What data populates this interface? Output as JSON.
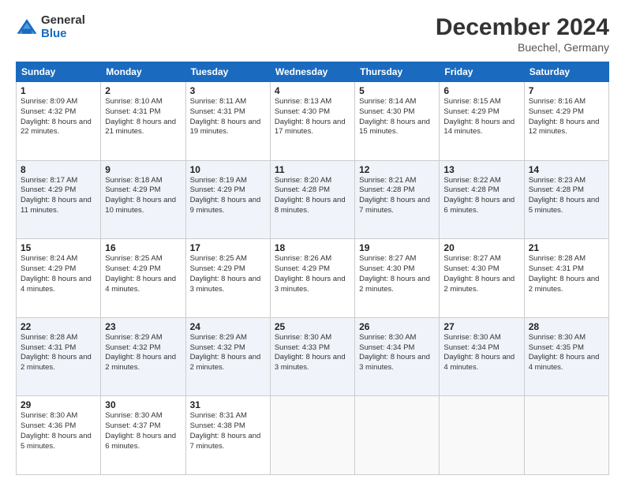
{
  "logo": {
    "general": "General",
    "blue": "Blue"
  },
  "title": "December 2024",
  "subtitle": "Buechel, Germany",
  "days_of_week": [
    "Sunday",
    "Monday",
    "Tuesday",
    "Wednesday",
    "Thursday",
    "Friday",
    "Saturday"
  ],
  "weeks": [
    [
      {
        "day": "1",
        "sunrise": "8:09 AM",
        "sunset": "4:32 PM",
        "daylight": "8 hours and 22 minutes."
      },
      {
        "day": "2",
        "sunrise": "8:10 AM",
        "sunset": "4:31 PM",
        "daylight": "8 hours and 21 minutes."
      },
      {
        "day": "3",
        "sunrise": "8:11 AM",
        "sunset": "4:31 PM",
        "daylight": "8 hours and 19 minutes."
      },
      {
        "day": "4",
        "sunrise": "8:13 AM",
        "sunset": "4:30 PM",
        "daylight": "8 hours and 17 minutes."
      },
      {
        "day": "5",
        "sunrise": "8:14 AM",
        "sunset": "4:30 PM",
        "daylight": "8 hours and 15 minutes."
      },
      {
        "day": "6",
        "sunrise": "8:15 AM",
        "sunset": "4:29 PM",
        "daylight": "8 hours and 14 minutes."
      },
      {
        "day": "7",
        "sunrise": "8:16 AM",
        "sunset": "4:29 PM",
        "daylight": "8 hours and 12 minutes."
      }
    ],
    [
      {
        "day": "8",
        "sunrise": "8:17 AM",
        "sunset": "4:29 PM",
        "daylight": "8 hours and 11 minutes."
      },
      {
        "day": "9",
        "sunrise": "8:18 AM",
        "sunset": "4:29 PM",
        "daylight": "8 hours and 10 minutes."
      },
      {
        "day": "10",
        "sunrise": "8:19 AM",
        "sunset": "4:29 PM",
        "daylight": "8 hours and 9 minutes."
      },
      {
        "day": "11",
        "sunrise": "8:20 AM",
        "sunset": "4:28 PM",
        "daylight": "8 hours and 8 minutes."
      },
      {
        "day": "12",
        "sunrise": "8:21 AM",
        "sunset": "4:28 PM",
        "daylight": "8 hours and 7 minutes."
      },
      {
        "day": "13",
        "sunrise": "8:22 AM",
        "sunset": "4:28 PM",
        "daylight": "8 hours and 6 minutes."
      },
      {
        "day": "14",
        "sunrise": "8:23 AM",
        "sunset": "4:28 PM",
        "daylight": "8 hours and 5 minutes."
      }
    ],
    [
      {
        "day": "15",
        "sunrise": "8:24 AM",
        "sunset": "4:29 PM",
        "daylight": "8 hours and 4 minutes."
      },
      {
        "day": "16",
        "sunrise": "8:25 AM",
        "sunset": "4:29 PM",
        "daylight": "8 hours and 4 minutes."
      },
      {
        "day": "17",
        "sunrise": "8:25 AM",
        "sunset": "4:29 PM",
        "daylight": "8 hours and 3 minutes."
      },
      {
        "day": "18",
        "sunrise": "8:26 AM",
        "sunset": "4:29 PM",
        "daylight": "8 hours and 3 minutes."
      },
      {
        "day": "19",
        "sunrise": "8:27 AM",
        "sunset": "4:30 PM",
        "daylight": "8 hours and 2 minutes."
      },
      {
        "day": "20",
        "sunrise": "8:27 AM",
        "sunset": "4:30 PM",
        "daylight": "8 hours and 2 minutes."
      },
      {
        "day": "21",
        "sunrise": "8:28 AM",
        "sunset": "4:31 PM",
        "daylight": "8 hours and 2 minutes."
      }
    ],
    [
      {
        "day": "22",
        "sunrise": "8:28 AM",
        "sunset": "4:31 PM",
        "daylight": "8 hours and 2 minutes."
      },
      {
        "day": "23",
        "sunrise": "8:29 AM",
        "sunset": "4:32 PM",
        "daylight": "8 hours and 2 minutes."
      },
      {
        "day": "24",
        "sunrise": "8:29 AM",
        "sunset": "4:32 PM",
        "daylight": "8 hours and 2 minutes."
      },
      {
        "day": "25",
        "sunrise": "8:30 AM",
        "sunset": "4:33 PM",
        "daylight": "8 hours and 3 minutes."
      },
      {
        "day": "26",
        "sunrise": "8:30 AM",
        "sunset": "4:34 PM",
        "daylight": "8 hours and 3 minutes."
      },
      {
        "day": "27",
        "sunrise": "8:30 AM",
        "sunset": "4:34 PM",
        "daylight": "8 hours and 4 minutes."
      },
      {
        "day": "28",
        "sunrise": "8:30 AM",
        "sunset": "4:35 PM",
        "daylight": "8 hours and 4 minutes."
      }
    ],
    [
      {
        "day": "29",
        "sunrise": "8:30 AM",
        "sunset": "4:36 PM",
        "daylight": "8 hours and 5 minutes."
      },
      {
        "day": "30",
        "sunrise": "8:30 AM",
        "sunset": "4:37 PM",
        "daylight": "8 hours and 6 minutes."
      },
      {
        "day": "31",
        "sunrise": "8:31 AM",
        "sunset": "4:38 PM",
        "daylight": "8 hours and 7 minutes."
      },
      null,
      null,
      null,
      null
    ]
  ],
  "labels": {
    "sunrise": "Sunrise:",
    "sunset": "Sunset:",
    "daylight": "Daylight:"
  }
}
